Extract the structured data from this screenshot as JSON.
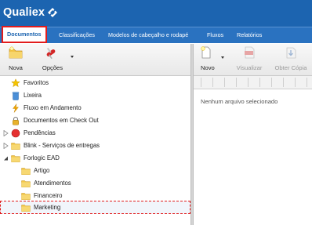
{
  "app": {
    "name": "Qualiex"
  },
  "nav": [
    {
      "label": "Documentos",
      "active": true
    },
    {
      "label": "Classificações",
      "active": false
    },
    {
      "label": "Modelos de cabeçalho e rodapé",
      "active": false
    },
    {
      "label": "Fluxos",
      "active": false
    },
    {
      "label": "Relatórios",
      "active": false
    }
  ],
  "toolbar_left": {
    "nova_label": "Nova",
    "opcoes_label": "Opções"
  },
  "toolbar_right": {
    "novo_label": "Novo",
    "visualizar_label": "Visualizar",
    "obter_copia_label": "Obter Cópia"
  },
  "tree": [
    {
      "label": "Favoritos",
      "icon": "star-icon"
    },
    {
      "label": "Lixeira",
      "icon": "trash-icon"
    },
    {
      "label": "Fluxo em Andamento",
      "icon": "lightning-icon"
    },
    {
      "label": "Documentos em Check Out",
      "icon": "lock-icon"
    },
    {
      "label": "Pendências",
      "icon": "red-circle-icon",
      "collapsed": true
    },
    {
      "label": "Blink - Serviços de entregas",
      "icon": "folder-icon",
      "collapsed": true
    },
    {
      "label": "Forlogic EAD",
      "icon": "folder-icon",
      "expanded": true
    },
    {
      "label": "Artigo",
      "icon": "folder-icon"
    },
    {
      "label": "Atendimentos",
      "icon": "folder-icon"
    },
    {
      "label": "Financeiro",
      "icon": "folder-icon"
    },
    {
      "label": "Marketing",
      "icon": "folder-icon",
      "selected": true
    }
  ],
  "content": {
    "empty_message": "Nenhum arquivo selecionado"
  },
  "colors": {
    "header": "#1c64b0",
    "nav": "#2a72c0",
    "highlight": "#e21c1c"
  }
}
